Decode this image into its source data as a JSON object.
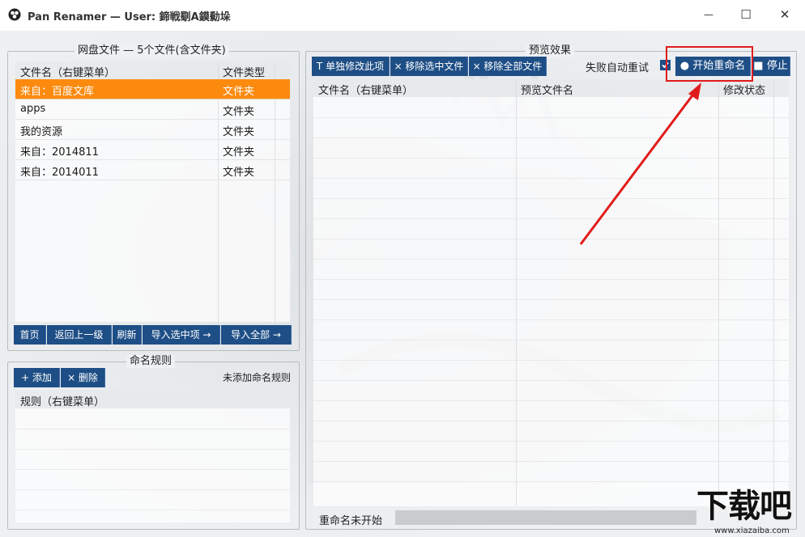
{
  "window": {
    "title": "Pan Renamer — User: 鍗戦劅A鏌勬垛",
    "minimize_glyph": "—",
    "maximize_glyph": "☐",
    "close_glyph": "✕"
  },
  "files_panel": {
    "title": "网盘文件 — 5个文件(含文件夹)",
    "columns": [
      "文件名（右键菜单）",
      "文件类型"
    ],
    "rows": [
      {
        "name": "来自：百度文库",
        "type": "文件夹",
        "selected": true
      },
      {
        "name": "apps",
        "type": "文件夹",
        "selected": false
      },
      {
        "name": "我的资源",
        "type": "文件夹",
        "selected": false
      },
      {
        "name": "来自：2014811",
        "type": "文件夹",
        "selected": false
      },
      {
        "name": "来自：2014011",
        "type": "文件夹",
        "selected": false
      }
    ],
    "buttons": {
      "home": "首页",
      "up": "返回上一级",
      "refresh": "刷新",
      "import_selected": "导入选中项 →",
      "import_all": "导入全部 →"
    }
  },
  "rules_panel": {
    "title": "命名规则",
    "add_label": "+ 添加",
    "delete_label": "× 删除",
    "status": "未添加命名规则",
    "column": "规则（右键菜单）"
  },
  "preview_panel": {
    "title": "预览效果",
    "buttons": {
      "edit_single": "T 单独修改此项",
      "remove_selected": "× 移除选中文件",
      "remove_all": "× 移除全部文件",
      "start": "● 开始重命名",
      "stop": "■ 停止"
    },
    "retry_label": "失败自动重试",
    "retry_checked": true,
    "columns": [
      "文件名（右键菜单）",
      "预览文件名",
      "修改状态"
    ],
    "status": "重命名未开始",
    "progress": 0
  },
  "watermark": {
    "text": "下载吧",
    "url": "www.xiazaiba.com"
  },
  "colors": {
    "accent": "#1e4e86",
    "selected_row": "#fb8a0f",
    "annotation": "#e11b1b"
  }
}
